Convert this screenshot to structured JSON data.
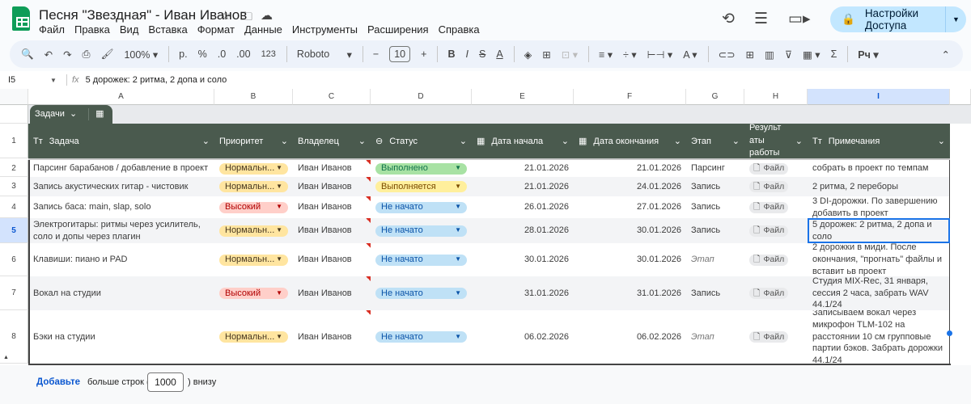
{
  "app": {
    "title": "Песня \"Звездная\" - Иван Иванов",
    "menu": [
      "Файл",
      "Правка",
      "Вид",
      "Вставка",
      "Формат",
      "Данные",
      "Инструменты",
      "Расширения",
      "Справка"
    ],
    "share_label": "Настройки Доступа",
    "accent": "#c2e7ff"
  },
  "toolbar": {
    "zoom": "100%",
    "currency": "р.",
    "percent": "%",
    "dec_less": ".0",
    "dec_more": ".00",
    "format_123": "123",
    "font": "Roboto",
    "font_size": "10",
    "input_tools": "Рч"
  },
  "formula_bar": {
    "cell_ref": "I5",
    "fx": "fx",
    "content": "5 дорожек: 2 ритма, 2 допа и соло"
  },
  "columns": [
    "A",
    "B",
    "C",
    "D",
    "E",
    "F",
    "G",
    "H",
    "I"
  ],
  "table": {
    "name": "Задачи",
    "headers": [
      "Задача",
      "Приоритет",
      "Владелец",
      "Статус",
      "Дата начала",
      "Дата окончания",
      "Этап",
      "Результ аты работы",
      "Примечания"
    ],
    "rows": [
      {
        "n": "2",
        "task": "Парсинг барабанов / добавление в проект",
        "priority": "Нормальн...",
        "owner": "Иван Иванов",
        "status": "Выполнено",
        "start": "21.01.2026",
        "end": "21.01.2026",
        "stage": "Парсинг",
        "result": "Файл",
        "notes": "собрать в проект по темпам"
      },
      {
        "n": "3",
        "task": "Запись акустических гитар - чистовик",
        "priority": "Нормальн...",
        "owner": "Иван Иванов",
        "status": "Выполняется",
        "start": "21.01.2026",
        "end": "24.01.2026",
        "stage": "Запись",
        "result": "Файл",
        "notes": "2 ритма, 2 переборы"
      },
      {
        "n": "4",
        "task": "Запись баса: main, slap, solo",
        "priority": "Высокий",
        "owner": "Иван Иванов",
        "status": "Не начато",
        "start": "26.01.2026",
        "end": "27.01.2026",
        "stage": "Запись",
        "result": "Файл",
        "notes": "3 DI-дорожки. По завершению добавить в проект"
      },
      {
        "n": "5",
        "task": "Электрогитары: ритмы через усилитель, соло и допы через плагин",
        "priority": "Нормальн...",
        "owner": "Иван Иванов",
        "status": "Не начато",
        "start": "28.01.2026",
        "end": "30.01.2026",
        "stage": "Запись",
        "result": "Файл",
        "notes": "5 дорожек: 2 ритма, 2 допа и соло"
      },
      {
        "n": "6",
        "task": "Клавиши: пиано и PAD",
        "priority": "Нормальн...",
        "owner": "Иван Иванов",
        "status": "Не начато",
        "start": "30.01.2026",
        "end": "30.01.2026",
        "stage": "Этап",
        "result": "Файл",
        "notes": "2 дорожки в миди. После окончания, \"прогнать\" файлы и вставит ьв проект"
      },
      {
        "n": "7",
        "task": "Вокал на студии",
        "priority": "Высокий",
        "owner": "Иван Иванов",
        "status": "Не начато",
        "start": "31.01.2026",
        "end": "31.01.2026",
        "stage": "Запись",
        "result": "Файл",
        "notes": "Студия MIX-Rec, 31 января, сессия 2 часа, забрать WAV 44.1/24"
      },
      {
        "n": "8",
        "task": "Бэки на студии",
        "priority": "Нормальн...",
        "owner": "Иван Иванов",
        "status": "Не начато",
        "start": "06.02.2026",
        "end": "06.02.2026",
        "stage": "Этап",
        "result": "Файл",
        "notes": "Записываем вокал через микрофон TLM-102 на расстоянии 10 см групповые партии бэков. Забрать дорожки 44.1/24"
      }
    ]
  },
  "chip_colors": {
    "Нормальн...": [
      "#ffe5a0",
      "#473821"
    ],
    "Высокий": [
      "#ffcfc9",
      "#b10202"
    ],
    "Выполнено": [
      "#a8e2a4",
      "#11734b"
    ],
    "Выполняется": [
      "#ffef9c",
      "#7a4b00"
    ],
    "Не начато": [
      "#bfe1f6",
      "#0a53a8"
    ]
  },
  "footer": {
    "add_label": "Добавьте",
    "more_rows": "больше строк (",
    "count": "1000",
    "below": ") внизу"
  }
}
